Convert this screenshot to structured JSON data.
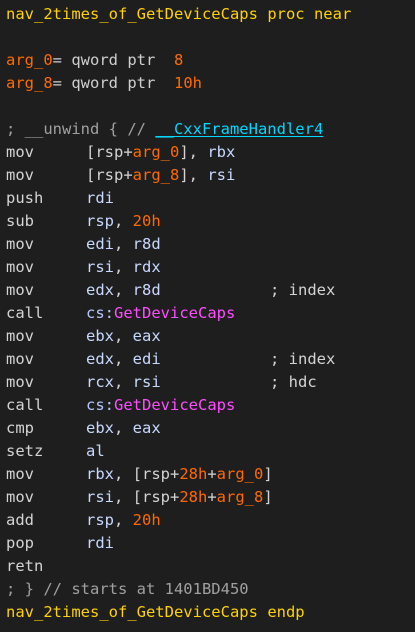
{
  "colors": {
    "background": "#1e1e1e",
    "keyword": "#ffd200",
    "number": "#ff6a00",
    "register": "#c8d9ff",
    "function": "#ff4dff",
    "link": "#00d8ff",
    "comment": "#a0a0a0"
  },
  "proc": {
    "name": "nav_2times_of_GetDeviceCaps",
    "keyword": "proc near"
  },
  "args": [
    {
      "name": "arg_0",
      "eq": "=",
      "type": " qword ptr  ",
      "value": "8"
    },
    {
      "name": "arg_8",
      "eq": "=",
      "type": " qword ptr  ",
      "value": "10h"
    }
  ],
  "unwind": {
    "prefix": "; __unwind { // ",
    "handler": "__CxxFrameHandler4"
  },
  "instructions": [
    {
      "mnemonic": "mov",
      "parts": [
        {
          "t": "[rsp+",
          "c": "plain"
        },
        {
          "t": "arg_0",
          "c": "num"
        },
        {
          "t": "], ",
          "c": "plain"
        },
        {
          "t": "rbx",
          "c": "reg"
        }
      ]
    },
    {
      "mnemonic": "mov",
      "parts": [
        {
          "t": "[rsp+",
          "c": "plain"
        },
        {
          "t": "arg_8",
          "c": "num"
        },
        {
          "t": "], ",
          "c": "plain"
        },
        {
          "t": "rsi",
          "c": "reg"
        }
      ]
    },
    {
      "mnemonic": "push",
      "parts": [
        {
          "t": "rdi",
          "c": "reg"
        }
      ]
    },
    {
      "mnemonic": "sub",
      "parts": [
        {
          "t": "rsp",
          "c": "reg"
        },
        {
          "t": ", ",
          "c": "plain"
        },
        {
          "t": "20h",
          "c": "num"
        }
      ]
    },
    {
      "mnemonic": "mov",
      "parts": [
        {
          "t": "edi",
          "c": "reg"
        },
        {
          "t": ", ",
          "c": "plain"
        },
        {
          "t": "r8d",
          "c": "reg"
        }
      ]
    },
    {
      "mnemonic": "mov",
      "parts": [
        {
          "t": "rsi",
          "c": "reg"
        },
        {
          "t": ", ",
          "c": "plain"
        },
        {
          "t": "rdx",
          "c": "reg"
        }
      ]
    },
    {
      "mnemonic": "mov",
      "parts": [
        {
          "t": "edx",
          "c": "reg"
        },
        {
          "t": ", ",
          "c": "plain"
        },
        {
          "t": "r8d",
          "c": "reg"
        }
      ],
      "comment": "; index"
    },
    {
      "mnemonic": "call",
      "parts": [
        {
          "t": "cs:",
          "c": "seg"
        },
        {
          "t": "GetDeviceCaps",
          "c": "fn"
        }
      ]
    },
    {
      "mnemonic": "mov",
      "parts": [
        {
          "t": "ebx",
          "c": "reg"
        },
        {
          "t": ", ",
          "c": "plain"
        },
        {
          "t": "eax",
          "c": "reg"
        }
      ]
    },
    {
      "mnemonic": "mov",
      "parts": [
        {
          "t": "edx",
          "c": "reg"
        },
        {
          "t": ", ",
          "c": "plain"
        },
        {
          "t": "edi",
          "c": "reg"
        }
      ],
      "comment": "; index"
    },
    {
      "mnemonic": "mov",
      "parts": [
        {
          "t": "rcx",
          "c": "reg"
        },
        {
          "t": ", ",
          "c": "plain"
        },
        {
          "t": "rsi",
          "c": "reg"
        }
      ],
      "comment": "; hdc"
    },
    {
      "mnemonic": "call",
      "parts": [
        {
          "t": "cs:",
          "c": "seg"
        },
        {
          "t": "GetDeviceCaps",
          "c": "fn"
        }
      ]
    },
    {
      "mnemonic": "cmp",
      "parts": [
        {
          "t": "ebx",
          "c": "reg"
        },
        {
          "t": ", ",
          "c": "plain"
        },
        {
          "t": "eax",
          "c": "reg"
        }
      ]
    },
    {
      "mnemonic": "setz",
      "parts": [
        {
          "t": "al",
          "c": "reg"
        }
      ]
    },
    {
      "mnemonic": "mov",
      "parts": [
        {
          "t": "rbx",
          "c": "reg"
        },
        {
          "t": ", [rsp+",
          "c": "plain"
        },
        {
          "t": "28h",
          "c": "num"
        },
        {
          "t": "+",
          "c": "plain"
        },
        {
          "t": "arg_0",
          "c": "num"
        },
        {
          "t": "]",
          "c": "plain"
        }
      ]
    },
    {
      "mnemonic": "mov",
      "parts": [
        {
          "t": "rsi",
          "c": "reg"
        },
        {
          "t": ", [rsp+",
          "c": "plain"
        },
        {
          "t": "28h",
          "c": "num"
        },
        {
          "t": "+",
          "c": "plain"
        },
        {
          "t": "arg_8",
          "c": "num"
        },
        {
          "t": "]",
          "c": "plain"
        }
      ]
    },
    {
      "mnemonic": "add",
      "parts": [
        {
          "t": "rsp",
          "c": "reg"
        },
        {
          "t": ", ",
          "c": "plain"
        },
        {
          "t": "20h",
          "c": "num"
        }
      ]
    },
    {
      "mnemonic": "pop",
      "parts": [
        {
          "t": "rdi",
          "c": "reg"
        }
      ]
    },
    {
      "mnemonic": "retn",
      "parts": []
    }
  ],
  "footer_comment": "; } // starts at 1401BD450",
  "endp": {
    "name": "nav_2times_of_GetDeviceCaps",
    "keyword": "endp"
  }
}
